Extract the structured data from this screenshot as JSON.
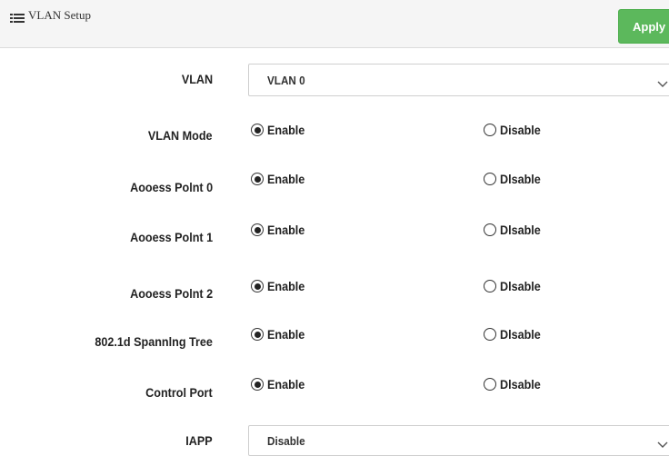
{
  "header": {
    "title": "VLAN Setup",
    "icon": "list-icon",
    "apply_label": "Apply",
    "apply_color": "#5cb85c"
  },
  "fields": {
    "vlan": {
      "label": "VLAN",
      "value": "VLAN 0"
    },
    "vlan_mode": {
      "label": "VLAN Mode",
      "enable": "Enable",
      "disable": "Disable",
      "selected": "Enable"
    },
    "access_point_0": {
      "label": "Aooess Polnt 0",
      "enable": "Enable",
      "disable": "Dlsable",
      "selected": "Enable"
    },
    "access_point_1": {
      "label": "Aooess Polnt 1",
      "enable": "Enable",
      "disable": "Dlsable",
      "selected": "Enable"
    },
    "access_point_2": {
      "label": "Aooess Polnt 2",
      "enable": "Enable",
      "disable": "Dlsable",
      "selected": "Enable"
    },
    "spanning_tree": {
      "label": "802.1d Spannlng Tree",
      "enable": "Enable",
      "disable": "Dlsable",
      "selected": "Enable"
    },
    "control_port": {
      "label": "Control Port",
      "enable": "Enable",
      "disable": "Dlsable",
      "selected": "Enable"
    },
    "iapp": {
      "label": "IAPP",
      "value": "Disable"
    }
  }
}
